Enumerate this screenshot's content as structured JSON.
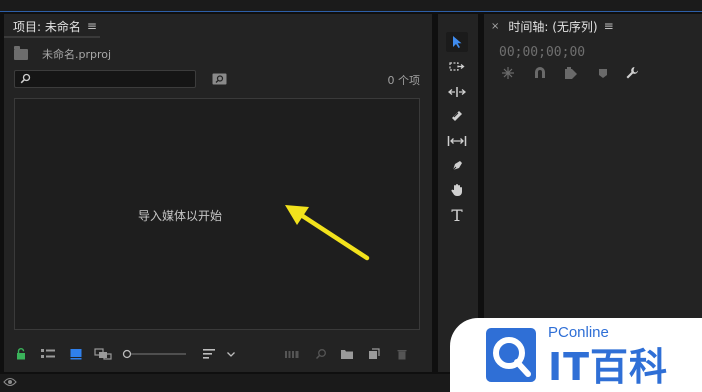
{
  "project": {
    "title": "项目: 未命名",
    "file_name": "未命名.prproj",
    "search_placeholder": "",
    "item_count": "0 个项",
    "drop_hint": "导入媒体以开始"
  },
  "timeline": {
    "title": "时间轴: (无序列)",
    "timecode": "00;00;00;00"
  },
  "tools": [
    "selection-tool",
    "track-select-tool",
    "ripple-edit-tool",
    "razor-tool",
    "slip-tool",
    "pen-tool",
    "hand-tool",
    "type-tool"
  ],
  "colors": {
    "accent": "#2f80ed",
    "arrow": "#f2e21c",
    "lock": "#3ab35a"
  },
  "watermark": {
    "brand": "PConline",
    "name": "IT百科"
  }
}
